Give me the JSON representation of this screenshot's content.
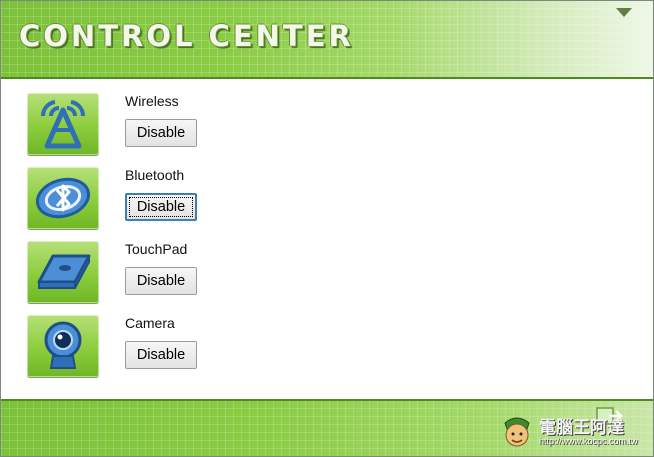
{
  "header": {
    "title": "CONTROL CENTER"
  },
  "devices": [
    {
      "label": "Wireless",
      "button": "Disable",
      "icon": "wireless-icon"
    },
    {
      "label": "Bluetooth",
      "button": "Disable",
      "icon": "bluetooth-icon"
    },
    {
      "label": "TouchPad",
      "button": "Disable",
      "icon": "touchpad-icon"
    },
    {
      "label": "Camera",
      "button": "Disable",
      "icon": "camera-icon"
    }
  ],
  "watermark": {
    "name": "電腦王阿達",
    "url": "http://www.kocpc.com.tw"
  },
  "colors": {
    "accent_green": "#8bcc45",
    "dark_green": "#4f8a1f",
    "icon_blue": "#2f6fb8"
  }
}
